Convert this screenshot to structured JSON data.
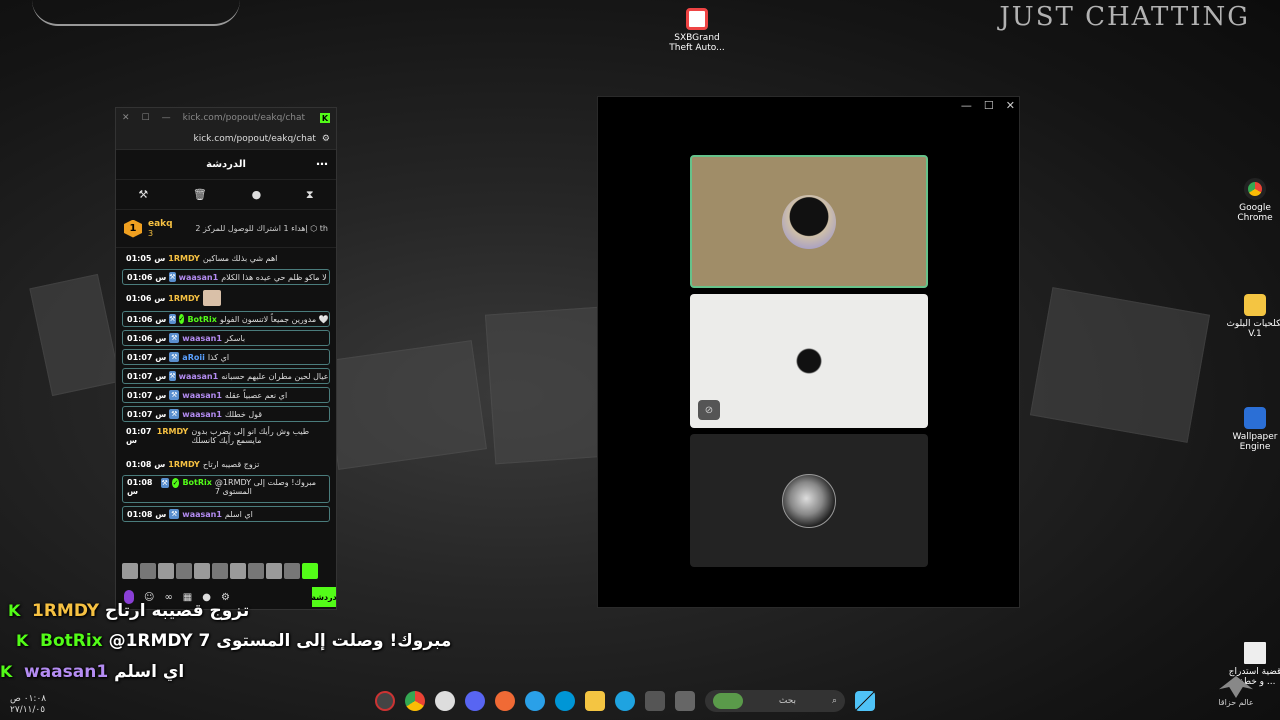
{
  "desktop": {
    "brand_text": "JUST CHATTING",
    "icons": [
      {
        "label": "SXBGrand Theft Auto...",
        "icon": "chrome-shortcut-icon"
      },
      {
        "label": "Google Chrome",
        "icon": "chrome-icon"
      },
      {
        "label": "تكلحيات البلوث V.1",
        "icon": "folder-icon"
      },
      {
        "label": "Wallpaper Engine",
        "icon": "wallpaper-engine-icon"
      },
      {
        "label": "قضية استدراج ... و خطف",
        "icon": "document-icon"
      }
    ]
  },
  "chat_window": {
    "tab_title": "kick.com/popout/eakq/chat -...",
    "url": "kick.com/popout/eakq/chat",
    "header_title": "الدردشة",
    "pinned": {
      "level": "1",
      "username": "eakq",
      "count": "3",
      "text": "إهداء 1 اشتراك للوصول للمركز 2 ⬡ th"
    },
    "messages": [
      {
        "time": "01:05 س",
        "user": "1RMDY",
        "user_color": "#f6c142",
        "text": "اهم شي بذلك مساكين",
        "boxed": false
      },
      {
        "time": "01:06 س",
        "user": "waasan1",
        "user_color": "#b48cf2",
        "text": "لا ماكو ظلم حي عيده هذا الكلام",
        "boxed": true
      },
      {
        "time": "01:06 س",
        "user": "1RMDY",
        "user_color": "#f6c142",
        "text": "",
        "boxed": false
      },
      {
        "time": "01:06 س",
        "user": "BotRix",
        "user_color": "#53fc18",
        "text": "مدورين جميعاً لاتنسون الفولو 🤍",
        "boxed": true
      },
      {
        "time": "01:06 س",
        "user": "waasan1",
        "user_color": "#b48cf2",
        "text": "باسكر",
        "boxed": true
      },
      {
        "time": "01:07 س",
        "user": "aRoii",
        "user_color": "#5aa0ff",
        "text": "اي كذا",
        "boxed": true
      },
      {
        "time": "01:07 س",
        "user": "waasan1",
        "user_color": "#b48cf2",
        "text": "عيال لحين مطران عليهم حسبانه",
        "boxed": true
      },
      {
        "time": "01:07 س",
        "user": "waasan1",
        "user_color": "#b48cf2",
        "text": "اي نعم عصبياً عقله",
        "boxed": true
      },
      {
        "time": "01:07 س",
        "user": "waasan1",
        "user_color": "#b48cf2",
        "text": "قول خطلك",
        "boxed": true
      },
      {
        "time": "01:07 س",
        "user": "1RMDY",
        "user_color": "#f6c142",
        "text": "طيب وش رأيك انو إلى يضرب بدون مايسمع رأيك كانسلك",
        "boxed": false
      },
      {
        "time": "01:08 س",
        "user": "1RMDY",
        "user_color": "#f6c142",
        "text": "تزوج قصيبه ارتاح",
        "boxed": false
      },
      {
        "time": "01:08 س",
        "user": "BotRix",
        "user_color": "#53fc18",
        "text": "@1RMDY مبروك! وصلت إلى المستوى 7",
        "boxed": true
      },
      {
        "time": "01:08 س",
        "user": "waasan1",
        "user_color": "#b48cf2",
        "text": "اي اسلم",
        "boxed": true
      }
    ],
    "send_label": "دردشة"
  },
  "overlay_chat": [
    {
      "user": "1RMDY",
      "user_color": "#f6c142",
      "text": "تزوج قصيبه ارتاح"
    },
    {
      "user": "BotRix",
      "user_color": "#53fc18",
      "text": "@1RMDY مبروك! وصلت إلى المستوى 7"
    },
    {
      "user": "waasan1",
      "user_color": "#b48cf2",
      "text": "اي اسلم"
    }
  ],
  "call_window": {
    "controls": [
      "minimize",
      "maximize",
      "close"
    ],
    "tiles": [
      {
        "bg": "#a08d68",
        "border": "#66c28a",
        "avatar": "cat-avatar",
        "muted": false
      },
      {
        "bg": "#ececea",
        "border": "#ececea",
        "avatar": "silhouette-avatar",
        "muted": true
      },
      {
        "bg": "#232323",
        "border": "#232323",
        "avatar": "eagle-moon-avatar",
        "muted": false
      }
    ]
  },
  "taskbar": {
    "clock_time": "٠١:٠٨ ص",
    "clock_date": "٢٧/١١/٠٥",
    "search_placeholder": "بحث",
    "corner_label": "عالم حزاقا"
  }
}
